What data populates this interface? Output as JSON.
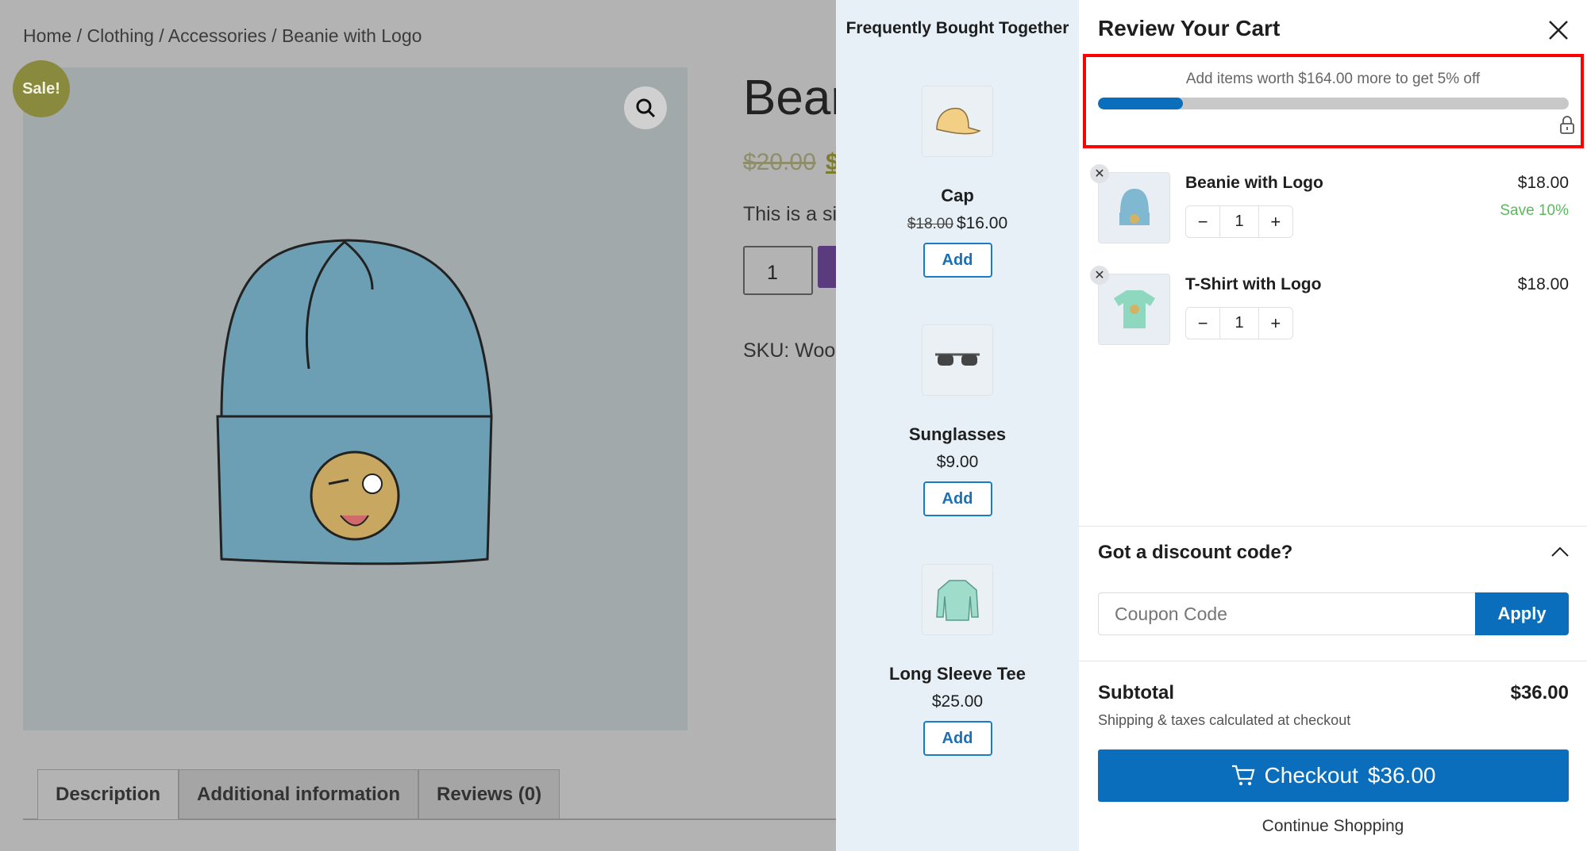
{
  "page": {
    "breadcrumb": "Home / Clothing / Accessories / Beanie with Logo",
    "sale_badge": "Sale!",
    "title": "Bear",
    "old_price": "$20.00",
    "new_price": "$",
    "description": "This is a si",
    "quantity": "1",
    "sku": "SKU: Woo-",
    "tabs": [
      "Description",
      "Additional information",
      "Reviews (0)"
    ]
  },
  "fbt": {
    "title": "Frequently Bought Together",
    "items": [
      {
        "name": "Cap",
        "old_price": "$18.00",
        "price": "$16.00",
        "button": "Add",
        "icon": "cap"
      },
      {
        "name": "Sunglasses",
        "price": "$9.00",
        "button": "Add",
        "icon": "sunglasses"
      },
      {
        "name": "Long Sleeve Tee",
        "price": "$25.00",
        "button": "Add",
        "icon": "long-sleeve-tee"
      }
    ]
  },
  "cart": {
    "title": "Review Your Cart",
    "progress": {
      "text": "Add items worth $164.00 more to get 5% off",
      "percent": 18,
      "color": "#0a6ebd"
    },
    "items": [
      {
        "name": "Beanie with Logo",
        "price": "$18.00",
        "qty": "1",
        "save": "Save 10%"
      },
      {
        "name": "T-Shirt with Logo",
        "price": "$18.00",
        "qty": "1"
      }
    ],
    "discount_title": "Got a discount code?",
    "coupon_placeholder": "Coupon Code",
    "apply": "Apply",
    "subtotal_label": "Subtotal",
    "subtotal": "$36.00",
    "shipping_note": "Shipping & taxes calculated at checkout",
    "checkout_label": "Checkout",
    "checkout_amount": "$36.00",
    "continue": "Continue Shopping",
    "accent": "#0a6ebd",
    "highlight": "#ff0000"
  }
}
